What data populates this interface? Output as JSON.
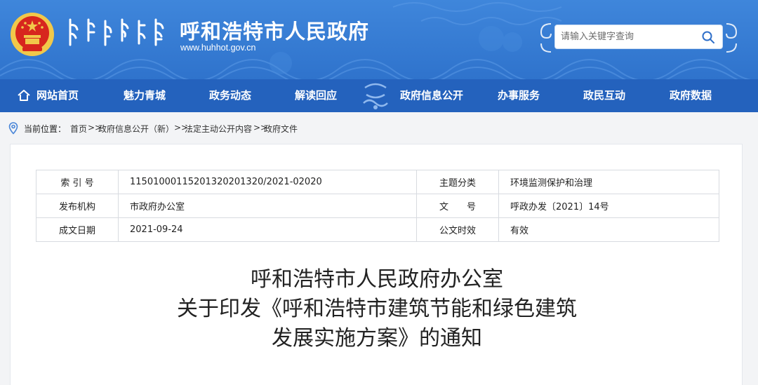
{
  "header": {
    "site_title": "呼和浩特市人民政府",
    "site_url": "www.huhhot.gov.cn",
    "search": {
      "placeholder": "请输入关键字查询"
    }
  },
  "nav": {
    "items": [
      {
        "label": "网站首页",
        "icon": "home-icon"
      },
      {
        "label": "魅力青城"
      },
      {
        "label": "政务动态"
      },
      {
        "label": "解读回应"
      },
      {
        "label": "政府信息公开"
      },
      {
        "label": "办事服务"
      },
      {
        "label": "政民互动"
      },
      {
        "label": "政府数据"
      }
    ]
  },
  "breadcrumb": {
    "label": "当前位置：",
    "separator": ">>",
    "items": [
      "首页",
      "政府信息公开（新）",
      "法定主动公开内容",
      "政府文件"
    ]
  },
  "meta_table": {
    "rows": [
      [
        "索 引 号",
        "1150100011520132020132​0/2021-02020",
        "主题分类",
        "环境监测保护和治理"
      ],
      [
        "发布机构",
        "市政府办公室",
        "文　　号",
        "呼政办发〔2021〕14号"
      ],
      [
        "成文日期",
        "2021-09-24",
        "公文时效",
        "有效"
      ]
    ]
  },
  "document": {
    "title_lines": [
      "呼和浩特市人民政府办公室",
      "关于印发《呼和浩特市建筑节能和绿色建筑",
      "发展实施方案》的通知"
    ]
  },
  "colors": {
    "header_blue": "#3a7fd6",
    "nav_blue": "#2462bd",
    "emblem_red": "#d7261e",
    "emblem_gold": "#f1c84a"
  }
}
